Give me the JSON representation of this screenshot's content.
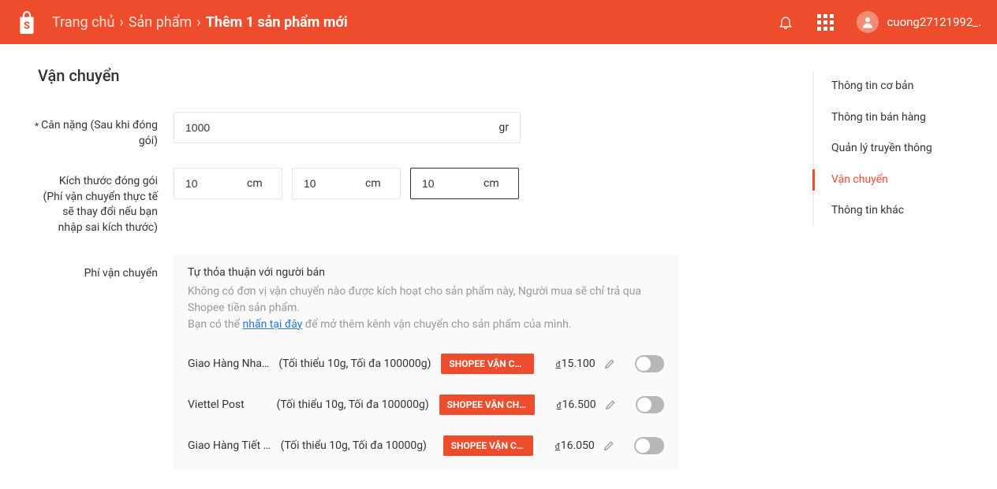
{
  "header": {
    "breadcrumb": {
      "home": "Trang chủ",
      "products": "Sản phẩm",
      "current": "Thêm 1 sản phẩm mới"
    },
    "username": "cuong27121992_."
  },
  "section": {
    "title": "Vận chuyển",
    "weight_label": "Cân nặng (Sau khi đóng gói)",
    "weight_value": "1000",
    "weight_unit": "gr",
    "dims_label": "Kích thước đóng gói (Phí vận chuyển thực tế sẽ thay đổi nếu bạn nhập sai kích thước)",
    "dim_unit": "cm",
    "dim_l": "10",
    "dim_w": "10",
    "dim_h": "10",
    "fee_label": "Phí vận chuyển"
  },
  "fee_panel": {
    "title": "Tự thỏa thuận với người bán",
    "desc1": "Không có đơn vị vận chuyển nào được kích hoạt cho sản phẩm này, Người mua sẽ chỉ trả qua Shopee tiền sản phẩm.",
    "desc2_prefix": "Bạn có thể ",
    "desc2_link": "nhấn tại đây",
    "desc2_suffix": " để mở thêm kênh vận chuyển cho sản phẩm của mình."
  },
  "carriers": [
    {
      "name": "Giao Hàng Nha…",
      "limits": "(Tối thiểu 10g, Tối đa 100000g)",
      "badge": "SHOPEE VẬN CHUY…",
      "price": "15.100"
    },
    {
      "name": "Viettel Post",
      "limits": "(Tối thiểu 10g, Tối đa 100000g)",
      "badge": "SHOPEE VẬN CHUYỂN",
      "price": "16.500"
    },
    {
      "name": "Giao Hàng Tiết K…",
      "limits": "(Tối thiểu 10g, Tối đa 10000g)",
      "badge": "SHOPEE VẬN CHU…",
      "price": "16.050"
    }
  ],
  "sidebar": {
    "items": [
      {
        "label": "Thông tin cơ bản"
      },
      {
        "label": "Thông tin bán hàng"
      },
      {
        "label": "Quản lý truyền thông"
      },
      {
        "label": "Vận chuyển"
      },
      {
        "label": "Thông tin khác"
      }
    ],
    "active_index": 3
  }
}
